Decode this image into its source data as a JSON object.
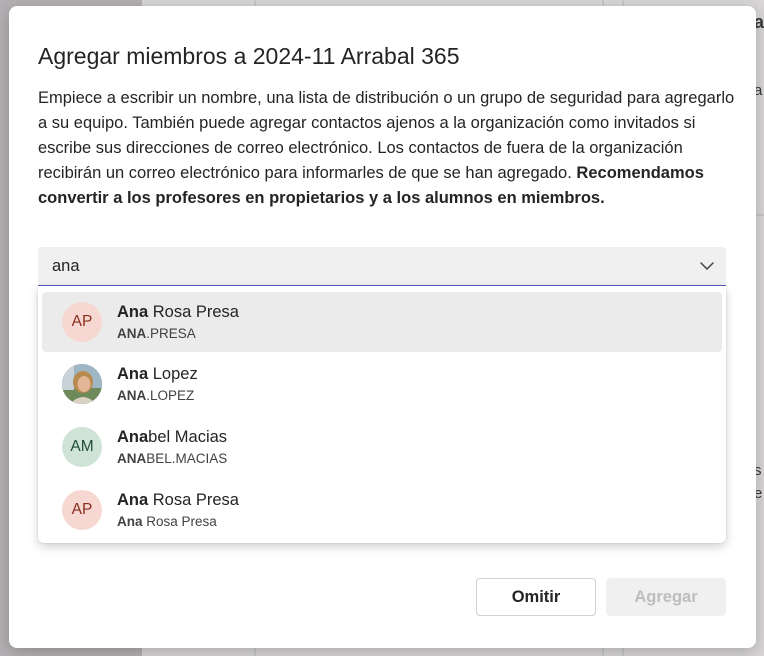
{
  "dialog": {
    "title": "Agregar miembros a 2024-11 Arrabal 365",
    "description": "Empiece a escribir un nombre, una lista de distribución o un grupo de seguridad para agregarlo a su equipo. También puede agregar contactos ajenos a la organización como invitados si escribe sus direcciones de correo electrónico. Los contactos de fuera de la organización recibirán un correo electrónico para informarles de que se han agregado.",
    "recommendation": "Recomendamos convertir a los profesores en propietarios y a los alumnos en miembros."
  },
  "search": {
    "value": "ana",
    "dropdown_icon": "chevron-down-icon"
  },
  "suggestions": [
    {
      "initials": "AP",
      "name_match": "Ana",
      "name_rest": " Rosa Presa",
      "sub_match": "ANA",
      "sub_rest": ".PRESA",
      "avatar": "peach"
    },
    {
      "initials": "",
      "name_match": "Ana",
      "name_rest": " Lopez",
      "sub_match": "ANA",
      "sub_rest": ".LOPEZ",
      "avatar": "photo"
    },
    {
      "initials": "AM",
      "name_match": "Ana",
      "name_rest": "bel Macias",
      "sub_match": "ANA",
      "sub_rest": "BEL.MACIAS",
      "avatar": "green"
    },
    {
      "initials": "AP",
      "name_match": "Ana",
      "name_rest": " Rosa Presa",
      "sub_match": "Ana",
      "sub_rest": " Rosa Presa",
      "avatar": "peach"
    }
  ],
  "buttons": {
    "omit": "Omitir",
    "add": "Agregar"
  },
  "background": {
    "fragment_1": "a",
    "fragment_2": "a",
    "fragment_3": "s",
    "fragment_4": "e"
  },
  "colors": {
    "accent": "#5b5fc7",
    "avatar_peach": "#f6d7d1",
    "avatar_green": "#cfe4d7"
  }
}
